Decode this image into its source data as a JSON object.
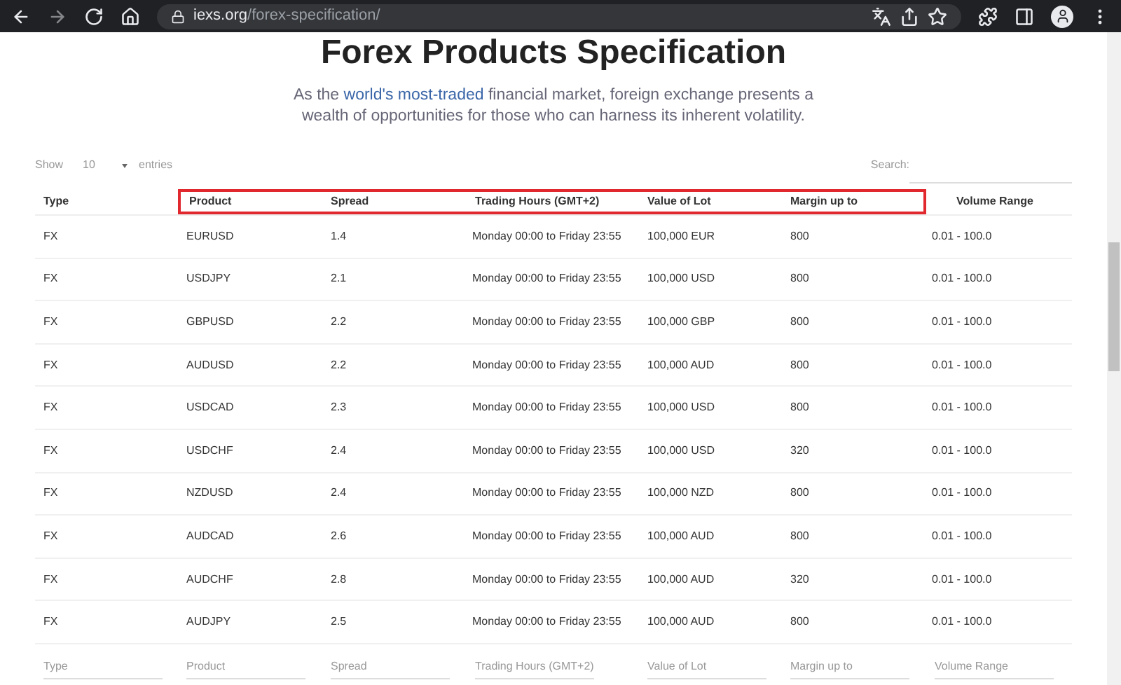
{
  "browser": {
    "url_host": "iexs.org",
    "url_path": "/forex-specification/"
  },
  "title": "Forex Products Specification",
  "subtitle": {
    "before": "As the ",
    "link": "world's most-traded",
    "after": " financial market, foreign exchange presents a wealth of opportunities for those who can harness its inherent volatility."
  },
  "length_control": {
    "label_before": "Show",
    "value": "10",
    "label_after": "entries"
  },
  "search": {
    "label": "Search:"
  },
  "table": {
    "columns": [
      {
        "label": "Type",
        "highlighted": false
      },
      {
        "label": "Product",
        "highlighted": true
      },
      {
        "label": "Spread",
        "highlighted": true
      },
      {
        "label": "Trading Hours (GMT+2)",
        "highlighted": true
      },
      {
        "label": "Value of Lot",
        "highlighted": true
      },
      {
        "label": "Margin up to",
        "highlighted": true
      },
      {
        "label": "Volume Range",
        "highlighted": false
      }
    ],
    "rows": [
      [
        "FX",
        "EURUSD",
        "1.4",
        "Monday 00:00 to Friday 23:55",
        "100,000 EUR",
        "800",
        "0.01 - 100.0"
      ],
      [
        "FX",
        "USDJPY",
        "2.1",
        "Monday 00:00 to Friday 23:55",
        "100,000 USD",
        "800",
        "0.01 - 100.0"
      ],
      [
        "FX",
        "GBPUSD",
        "2.2",
        "Monday 00:00 to Friday 23:55",
        "100,000 GBP",
        "800",
        "0.01 - 100.0"
      ],
      [
        "FX",
        "AUDUSD",
        "2.2",
        "Monday 00:00 to Friday 23:55",
        "100,000 AUD",
        "800",
        "0.01 - 100.0"
      ],
      [
        "FX",
        "USDCAD",
        "2.3",
        "Monday 00:00 to Friday 23:55",
        "100,000 USD",
        "800",
        "0.01 - 100.0"
      ],
      [
        "FX",
        "USDCHF",
        "2.4",
        "Monday 00:00 to Friday 23:55",
        "100,000 USD",
        "320",
        "0.01 - 100.0"
      ],
      [
        "FX",
        "NZDUSD",
        "2.4",
        "Monday 00:00 to Friday 23:55",
        "100,000 NZD",
        "800",
        "0.01 - 100.0"
      ],
      [
        "FX",
        "AUDCAD",
        "2.6",
        "Monday 00:00 to Friday 23:55",
        "100,000 AUD",
        "800",
        "0.01 - 100.0"
      ],
      [
        "FX",
        "AUDCHF",
        "2.8",
        "Monday 00:00 to Friday 23:55",
        "100,000 AUD",
        "320",
        "0.01 - 100.0"
      ],
      [
        "FX",
        "AUDJPY",
        "2.5",
        "Monday 00:00 to Friday 23:55",
        "100,000 AUD",
        "800",
        "0.01 - 100.0"
      ]
    ],
    "filter_placeholders": [
      "Type",
      "Product",
      "Spread",
      "Trading Hours (GMT+2)",
      "Value of Lot",
      "Margin up to",
      "Volume Range"
    ]
  }
}
